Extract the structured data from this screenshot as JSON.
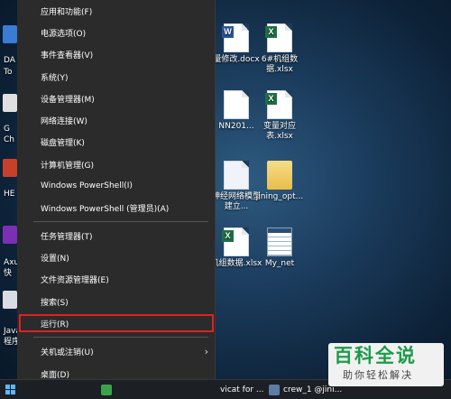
{
  "menu": {
    "items": [
      {
        "label": "应用和功能(F)"
      },
      {
        "label": "电源选项(O)"
      },
      {
        "label": "事件查看器(V)"
      },
      {
        "label": "系统(Y)"
      },
      {
        "label": "设备管理器(M)"
      },
      {
        "label": "网络连接(W)"
      },
      {
        "label": "磁盘管理(K)"
      },
      {
        "label": "计算机管理(G)"
      },
      {
        "label": "Windows PowerShell(I)"
      },
      {
        "label": "Windows PowerShell (管理员)(A)"
      },
      {
        "label": "任务管理器(T)"
      },
      {
        "label": "设置(N)"
      },
      {
        "label": "文件资源管理器(E)"
      },
      {
        "label": "搜索(S)"
      },
      {
        "label": "运行(R)"
      },
      {
        "label": "关机或注销(U)"
      },
      {
        "label": "桌面(D)"
      }
    ],
    "highlighted": "运行(R)",
    "submenu_indicator": "›"
  },
  "desktop": {
    "icons": [
      {
        "label": "量修改.docx",
        "type": "word"
      },
      {
        "label": "6#机组数据.xlsx",
        "type": "excel"
      },
      {
        "label": "NN201...",
        "type": "file"
      },
      {
        "label": "变量对应表.xlsx",
        "type": "excel"
      },
      {
        "label": "神经网络模型建立...",
        "type": "file"
      },
      {
        "label": "jining_opt...",
        "type": "folder"
      },
      {
        "label": "机组数据.xlsx",
        "type": "excel"
      },
      {
        "label": "My_net",
        "type": "table"
      }
    ],
    "left_labels": [
      "DA",
      "To",
      "G",
      "Ch",
      "HE",
      "Axu",
      "快",
      "Java",
      "程序"
    ]
  },
  "taskbar": {
    "items": [
      {
        "label": "vicat for ..."
      },
      {
        "label": "crew_1 @jini..."
      }
    ]
  },
  "watermark": {
    "main": "百科全说",
    "sub": "助你轻松解决"
  },
  "colors": {
    "menu_bg": "#2b2b2b",
    "highlight_border": "#e02020",
    "watermark_green": "#1a9b4a"
  }
}
